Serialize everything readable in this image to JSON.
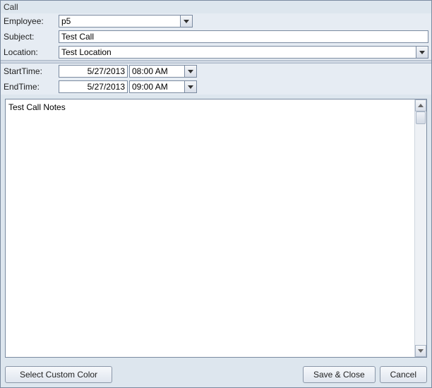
{
  "window": {
    "title": "Call"
  },
  "form": {
    "employee": {
      "label": "Employee:",
      "value": "p5"
    },
    "subject": {
      "label": "Subject:",
      "value": "Test Call"
    },
    "location": {
      "label": "Location:",
      "value": "Test Location"
    },
    "start": {
      "label": "StartTime:",
      "date": "5/27/2013",
      "time": "08:00 AM"
    },
    "end": {
      "label": "EndTime:",
      "date": "5/27/2013",
      "time": "09:00 AM"
    }
  },
  "notes": {
    "value": "Test Call Notes"
  },
  "buttons": {
    "selectColor": "Select Custom Color",
    "saveClose": "Save & Close",
    "cancel": "Cancel"
  }
}
